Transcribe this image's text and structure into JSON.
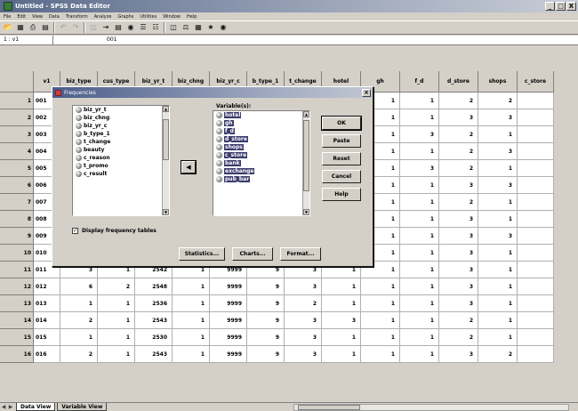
{
  "window": {
    "title": "Untitled - SPSS Data Editor",
    "buttons": [
      "_",
      "□",
      "X"
    ]
  },
  "menu": [
    "File",
    "Edit",
    "View",
    "Data",
    "Transform",
    "Analyze",
    "Graphs",
    "Utilities",
    "Window",
    "Help"
  ],
  "toolbar_icons": [
    "open-icon",
    "save-icon",
    "print-icon",
    "dialog-recall-icon",
    "undo-icon",
    "redo-icon",
    "goto-chart-icon",
    "goto-case-icon",
    "variables-icon",
    "find-icon",
    "insert-case-icon",
    "insert-variable-icon",
    "split-file-icon",
    "weight-cases-icon",
    "select-cases-icon",
    "value-labels-icon",
    "use-sets-icon"
  ],
  "cell_editor": {
    "ref": "1 : v1",
    "value": "001"
  },
  "columns": [
    "v1",
    "biz_type",
    "cus_type",
    "biz_yr_t",
    "biz_chng",
    "biz_yr_c",
    "b_type_1",
    "t_change",
    "hotel",
    "gh",
    "f_d",
    "d_store",
    "shops",
    "c_store"
  ],
  "rows": [
    [
      "1",
      "001",
      "",
      "",
      "",
      "",
      "",
      "",
      "",
      "1",
      "1",
      "1",
      "2",
      "2",
      ""
    ],
    [
      "2",
      "002",
      "",
      "",
      "",
      "",
      "",
      "",
      "",
      "1",
      "1",
      "1",
      "3",
      "3",
      ""
    ],
    [
      "3",
      "003",
      "",
      "",
      "",
      "",
      "",
      "",
      "",
      "1",
      "1",
      "3",
      "2",
      "1",
      ""
    ],
    [
      "4",
      "004",
      "",
      "",
      "",
      "",
      "",
      "",
      "",
      "1",
      "1",
      "1",
      "2",
      "3",
      ""
    ],
    [
      "5",
      "005",
      "",
      "",
      "",
      "",
      "",
      "",
      "",
      "1",
      "1",
      "3",
      "2",
      "1",
      ""
    ],
    [
      "6",
      "006",
      "",
      "",
      "",
      "",
      "",
      "",
      "",
      "1",
      "1",
      "1",
      "3",
      "3",
      ""
    ],
    [
      "7",
      "007",
      "",
      "",
      "",
      "",
      "",
      "",
      "",
      "1",
      "1",
      "1",
      "2",
      "1",
      ""
    ],
    [
      "8",
      "008",
      "",
      "",
      "",
      "",
      "",
      "",
      "",
      "1",
      "1",
      "1",
      "3",
      "1",
      ""
    ],
    [
      "9",
      "009",
      "",
      "",
      "",
      "",
      "",
      "",
      "",
      "1",
      "1",
      "1",
      "3",
      "3",
      ""
    ],
    [
      "10",
      "010",
      "3",
      "1",
      "9999",
      "1",
      "9999",
      "9",
      "3",
      "1",
      "1",
      "1",
      "3",
      "1",
      ""
    ],
    [
      "11",
      "011",
      "3",
      "1",
      "2542",
      "1",
      "9999",
      "9",
      "3",
      "1",
      "1",
      "1",
      "3",
      "1",
      ""
    ],
    [
      "12",
      "012",
      "6",
      "2",
      "2548",
      "1",
      "9999",
      "9",
      "3",
      "1",
      "1",
      "1",
      "3",
      "1",
      ""
    ],
    [
      "13",
      "013",
      "1",
      "1",
      "2536",
      "1",
      "9999",
      "9",
      "2",
      "1",
      "1",
      "1",
      "3",
      "1",
      ""
    ],
    [
      "14",
      "014",
      "2",
      "1",
      "2543",
      "1",
      "9999",
      "9",
      "3",
      "3",
      "1",
      "1",
      "2",
      "1",
      ""
    ],
    [
      "15",
      "015",
      "1",
      "1",
      "2530",
      "1",
      "9999",
      "9",
      "3",
      "1",
      "1",
      "1",
      "2",
      "1",
      ""
    ],
    [
      "16",
      "016",
      "2",
      "1",
      "2543",
      "1",
      "9999",
      "9",
      "3",
      "1",
      "1",
      "1",
      "3",
      "2",
      ""
    ]
  ],
  "tabs": {
    "data_view": "Data View",
    "variable_view": "Variable View"
  },
  "dialog": {
    "title": "Frequencies",
    "source_vars": [
      "biz_yr_t",
      "biz_chng",
      "biz_yr_c",
      "b_type_1",
      "t_change",
      "beauty",
      "c_reason",
      "t_promo",
      "c_result"
    ],
    "target_label": "Variable(s):",
    "target_vars": [
      "hotel",
      "gh",
      "f_d",
      "d_store",
      "shops",
      "c_store",
      "bank",
      "exchange",
      "pub_bar"
    ],
    "buttons": {
      "ok": "OK",
      "paste": "Paste",
      "reset": "Reset",
      "cancel": "Cancel",
      "help": "Help"
    },
    "checkbox_label": "Display frequency tables",
    "checkbox_checked": true,
    "bottom_buttons": {
      "statistics": "Statistics...",
      "charts": "Charts...",
      "format": "Format..."
    }
  }
}
